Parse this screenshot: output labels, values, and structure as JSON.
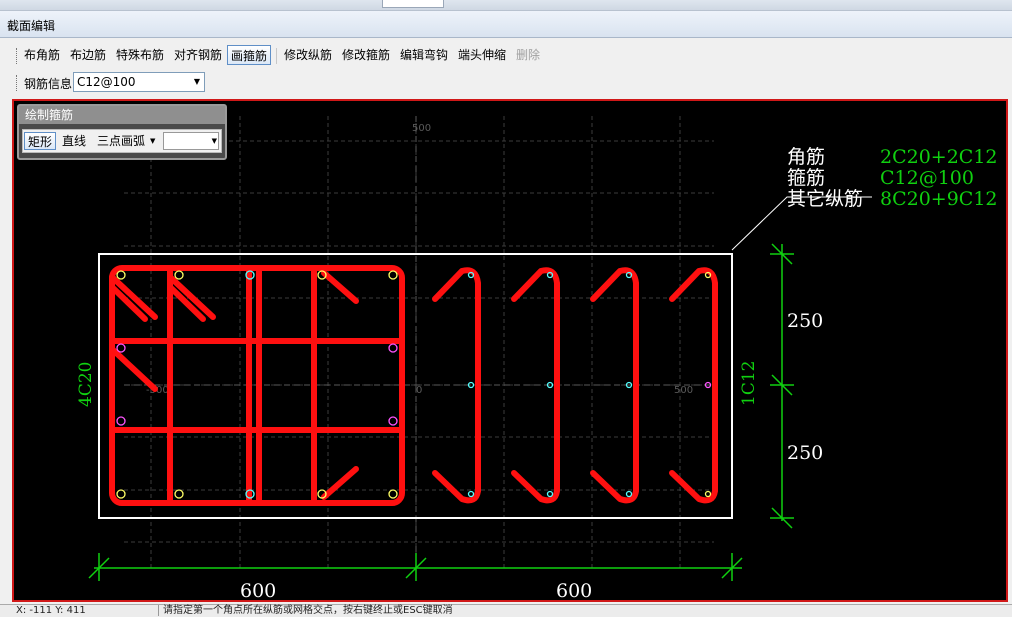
{
  "window": {
    "title": "截面编辑"
  },
  "toolbar": {
    "items": [
      {
        "label": "布角筋"
      },
      {
        "label": "布边筋"
      },
      {
        "label": "特殊布筋"
      },
      {
        "label": "对齐钢筋"
      },
      {
        "label": "画箍筋",
        "active": true
      },
      {
        "label": "修改纵筋"
      },
      {
        "label": "修改箍筋"
      },
      {
        "label": "编辑弯钩"
      },
      {
        "label": "端头伸缩"
      },
      {
        "label": "删除",
        "disabled": true
      }
    ]
  },
  "rebar_info": {
    "label": "钢筋信息",
    "value": "C12@100"
  },
  "draw_panel": {
    "title": "绘制箍筋",
    "rect": "矩形",
    "line": "直线",
    "arc": "三点画弧",
    "combo_value": ""
  },
  "annotations": {
    "corner_label": "角筋",
    "corner_value": "2C20+2C12",
    "stirrup_label": "箍筋",
    "stirrup_value": "C12@100",
    "other_label": "其它纵筋",
    "other_value": "8C20+9C12",
    "left_side": "4C20",
    "right_side": "1C12",
    "dim_top": "250",
    "dim_bottom": "250",
    "dim_left": "600",
    "dim_right": "600",
    "grid_top": "500",
    "grid_left": "-500",
    "grid_center": "0",
    "grid_right": "500"
  },
  "status": {
    "coords": "X: -111 Y: 411",
    "message": "请指定第一个角点所在纵筋或网格交点，按右键终止或ESC键取消"
  },
  "colors": {
    "rebar": "#ff1010",
    "dimension": "#10d010",
    "canvas": "#000000",
    "frame": "#d01818"
  }
}
